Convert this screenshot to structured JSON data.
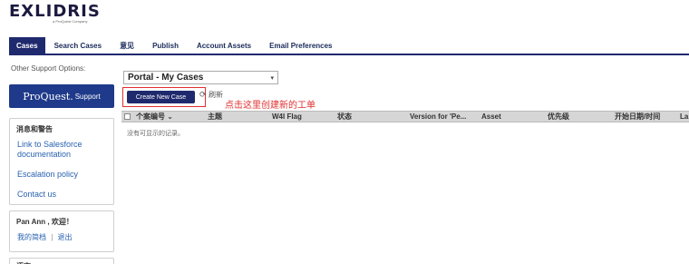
{
  "brand": {
    "logo": "EXLIDRIS",
    "sub": "a ProQuest Company"
  },
  "tabs": [
    {
      "label": "Cases",
      "active": true
    },
    {
      "label": "Search Cases"
    },
    {
      "label": "意见"
    },
    {
      "label": "Publish"
    },
    {
      "label": "Account Assets"
    },
    {
      "label": "Email Preferences"
    }
  ],
  "sidebar": {
    "other_label": "Other Support Options:",
    "proquest_button": {
      "main": "ProQuest.",
      "small": "Support"
    },
    "messages_box": {
      "title": "消息和警告",
      "links": [
        "Link to Salesforce documentation",
        "Escalation policy",
        "Contact us"
      ]
    },
    "user_box": {
      "greeting": "Pan Ann , 欢迎！",
      "profile_link": "我的简档",
      "separator": "|",
      "logout_link": "退出"
    },
    "third_box_title": "语言"
  },
  "main": {
    "view_select": {
      "value": "Portal - My Cases",
      "caret": "▾"
    },
    "create_button": "Create New Case",
    "toolbar_text": "刷新",
    "annotation": "点击这里创建新的工单",
    "columns": [
      "个案编号 ⌄",
      "主题",
      "W4I Flag",
      "状态",
      "Version for 'Pe...",
      "Asset",
      "优先级",
      "开始日期/时间",
      "La"
    ],
    "empty_message": "没有可显示的记录。"
  },
  "colors": {
    "navy": "#1f2a6e",
    "annotation_red": "#e03030",
    "link_blue": "#2a62b0"
  }
}
